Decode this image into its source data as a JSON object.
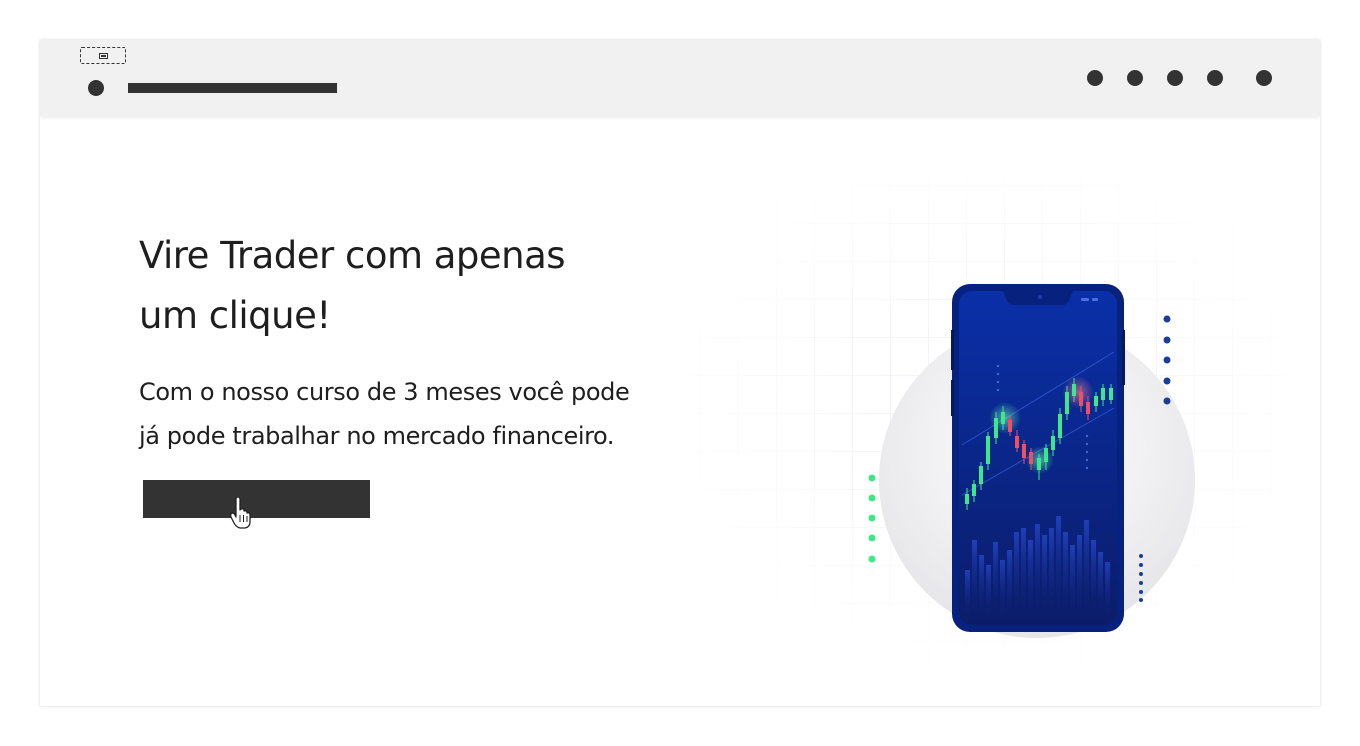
{
  "hero": {
    "headline_line1": "Vire Trader com apenas",
    "headline_line2": "um clique!",
    "subtext_line1": "Com o nosso curso de 3 meses você pode",
    "subtext_line2": "já pode trabalhar no mercado financeiro."
  },
  "colors": {
    "header_bg": "#f2f1f1",
    "dark": "#333333",
    "phone_blue": "#0a2a9c",
    "candle_green": "#3ee889",
    "candle_red": "#f04f63",
    "accent_navy": "#1a3d99"
  },
  "icons": {
    "image_placeholder": "image-icon",
    "cursor": "pointer-hand-icon"
  }
}
